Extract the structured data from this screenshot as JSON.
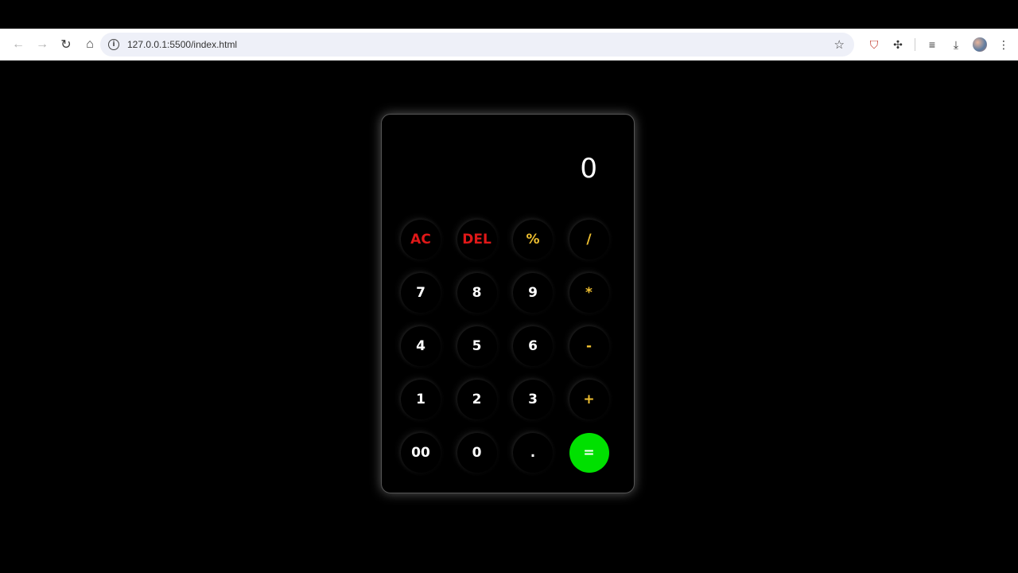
{
  "browser": {
    "url": "127.0.0.1:5500/index.html"
  },
  "calculator": {
    "display": "0",
    "rows": [
      [
        {
          "label": "AC",
          "tone": "red"
        },
        {
          "label": "DEL",
          "tone": "red"
        },
        {
          "label": "%",
          "tone": "yellow"
        },
        {
          "label": "/",
          "tone": "yellow"
        }
      ],
      [
        {
          "label": "7",
          "tone": "white"
        },
        {
          "label": "8",
          "tone": "white"
        },
        {
          "label": "9",
          "tone": "white"
        },
        {
          "label": "*",
          "tone": "yellow"
        }
      ],
      [
        {
          "label": "4",
          "tone": "white"
        },
        {
          "label": "5",
          "tone": "white"
        },
        {
          "label": "6",
          "tone": "white"
        },
        {
          "label": "-",
          "tone": "yellow"
        }
      ],
      [
        {
          "label": "1",
          "tone": "white"
        },
        {
          "label": "2",
          "tone": "white"
        },
        {
          "label": "3",
          "tone": "white"
        },
        {
          "label": "+",
          "tone": "yellow"
        }
      ],
      [
        {
          "label": "00",
          "tone": "white"
        },
        {
          "label": "0",
          "tone": "white"
        },
        {
          "label": ".",
          "tone": "white"
        },
        {
          "label": "=",
          "tone": "equal"
        }
      ]
    ]
  },
  "colors": {
    "red": "#e01818",
    "yellow": "#f0c030",
    "equal": "#00e000"
  }
}
